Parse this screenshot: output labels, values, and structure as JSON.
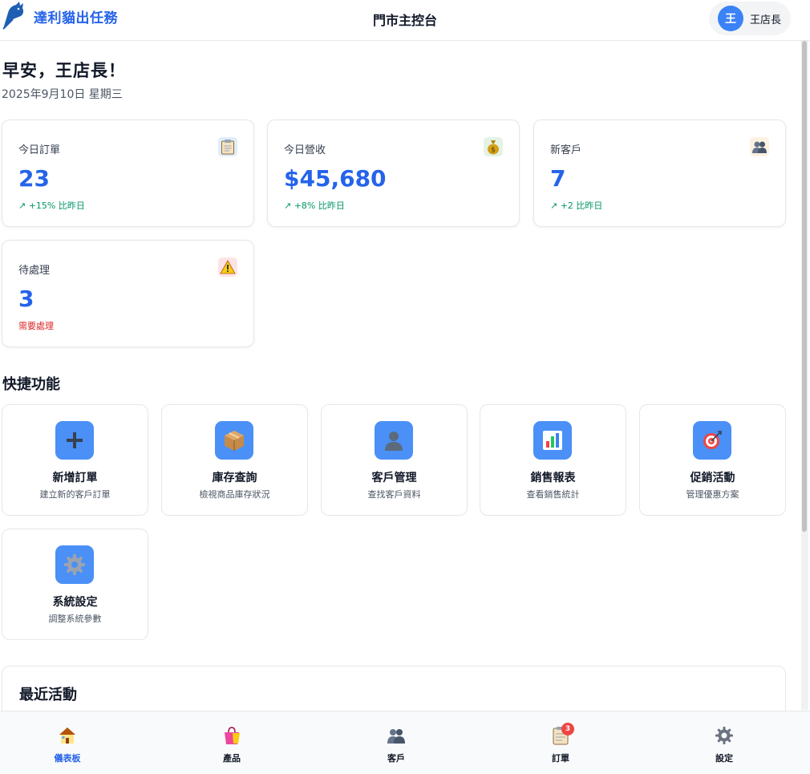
{
  "header": {
    "brand_name": "達利貓出任務",
    "title": "門市主控台",
    "user": {
      "avatar_initial": "王",
      "name": "王店長"
    }
  },
  "greeting": {
    "title": "早安，王店長！",
    "date": "2025年9月10日 星期三"
  },
  "stats": [
    {
      "label": "今日訂單",
      "value": "23",
      "trend": "↗ +15% 比昨日",
      "icon": "clipboard-icon"
    },
    {
      "label": "今日營收",
      "value": "$45,680",
      "trend": "↗ +8% 比昨日",
      "icon": "money-bag-icon"
    },
    {
      "label": "新客戶",
      "value": "7",
      "trend": "↗ +2 比昨日",
      "icon": "users-icon"
    },
    {
      "label": "待處理",
      "value": "3",
      "trend": "需要處理",
      "icon": "warning-icon"
    }
  ],
  "quick_actions": {
    "title": "快捷功能",
    "items": [
      {
        "title": "新增訂單",
        "desc": "建立新的客戶訂單",
        "icon": "plus-icon"
      },
      {
        "title": "庫存查詢",
        "desc": "檢視商品庫存狀況",
        "icon": "package-icon"
      },
      {
        "title": "客戶管理",
        "desc": "查找客戶資料",
        "icon": "user-icon"
      },
      {
        "title": "銷售報表",
        "desc": "查看銷售統計",
        "icon": "bar-chart-icon"
      },
      {
        "title": "促銷活動",
        "desc": "管理優惠方案",
        "icon": "target-icon"
      },
      {
        "title": "系統設定",
        "desc": "調整系統參數",
        "icon": "gear-icon"
      }
    ]
  },
  "recent_activity": {
    "title": "最近活動"
  },
  "bottom_nav": {
    "items": [
      {
        "label": "儀表板",
        "icon": "home-icon",
        "active": true
      },
      {
        "label": "產品",
        "icon": "shopping-bag-icon"
      },
      {
        "label": "客戶",
        "icon": "users-icon"
      },
      {
        "label": "訂單",
        "icon": "clipboard-icon",
        "badge": "3"
      },
      {
        "label": "設定",
        "icon": "gear-icon"
      }
    ]
  },
  "colors": {
    "accent": "#2563eb",
    "positive": "#059669",
    "warning": "#dc2626",
    "badge": "#ef4444",
    "tile_icon_bg": "#4a90f7"
  }
}
